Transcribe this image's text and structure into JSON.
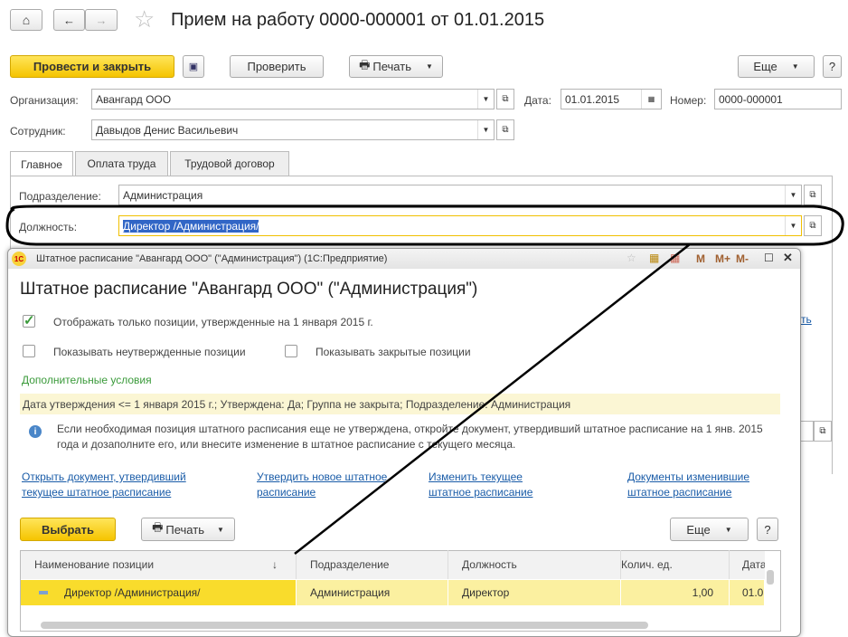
{
  "header": {
    "title": "Прием на работу 0000-000001 от 01.01.2015"
  },
  "toolbar": {
    "post_close": "Провести и закрыть",
    "check": "Проверить",
    "print": "Печать",
    "more": "Еще",
    "help": "?"
  },
  "form": {
    "org_label": "Организация:",
    "org_value": "Авангард ООО",
    "date_label": "Дата:",
    "date_value": "01.01.2015",
    "number_label": "Номер:",
    "number_value": "0000-000001",
    "employee_label": "Сотрудник:",
    "employee_value": "Давыдов Денис Васильевич",
    "tabs": [
      "Главное",
      "Оплата труда",
      "Трудовой договор"
    ],
    "dept_label": "Подразделение:",
    "dept_value": "Администрация",
    "position_label": "Должность:",
    "position_value": "Директор /Администрация/",
    "partial_link": "ть"
  },
  "popup": {
    "window_title": "Штатное расписание \"Авангард ООО\" (\"Администрация\")  (1С:Предприятие)",
    "title": "Штатное расписание \"Авангард ООО\" (\"Администрация\")",
    "title_buttons": [
      "M",
      "M+",
      "M-"
    ],
    "cb_only_approved": "Отображать только позиции, утвержденные на 1 января 2015 г.",
    "cb_unapproved": "Показывать неутвержденные позиции",
    "cb_closed": "Показывать закрытые позиции",
    "extra_conditions": "Дополнительные условия",
    "filter_text": "Дата утверждения <= 1 января 2015 г.; Утверждена: Да; Группа не закрыта; Подразделение: Администрация",
    "info_text": "Если необходимая позиция штатного расписания еще не утверждена, откройте документ, утвердивший штатное расписание на 1 янв. 2015 года и дозаполните его, или внесите изменение в штатное расписание с текущего месяца.",
    "links": [
      [
        "Открыть документ, утвердивший",
        "текущее штатное расписание"
      ],
      [
        "Утвердить новое штатное",
        "расписание"
      ],
      [
        "Изменить текущее",
        "штатное расписание"
      ],
      [
        "Документы изменившие",
        "штатное расписание"
      ]
    ],
    "select": "Выбрать",
    "print": "Печать",
    "more": "Еще",
    "help": "?",
    "columns": [
      "Наименование позиции",
      "Подразделение",
      "Должность",
      "Колич. ед.",
      "Дата"
    ],
    "sort_arrow": "↓",
    "rows": [
      [
        "Директор /Администрация/",
        "Администрация",
        "Директор",
        "1,00",
        "01.0"
      ]
    ]
  },
  "colors": {
    "accent": "#f5c400",
    "link": "#1a5ca8",
    "green": "#3a9a3a"
  }
}
